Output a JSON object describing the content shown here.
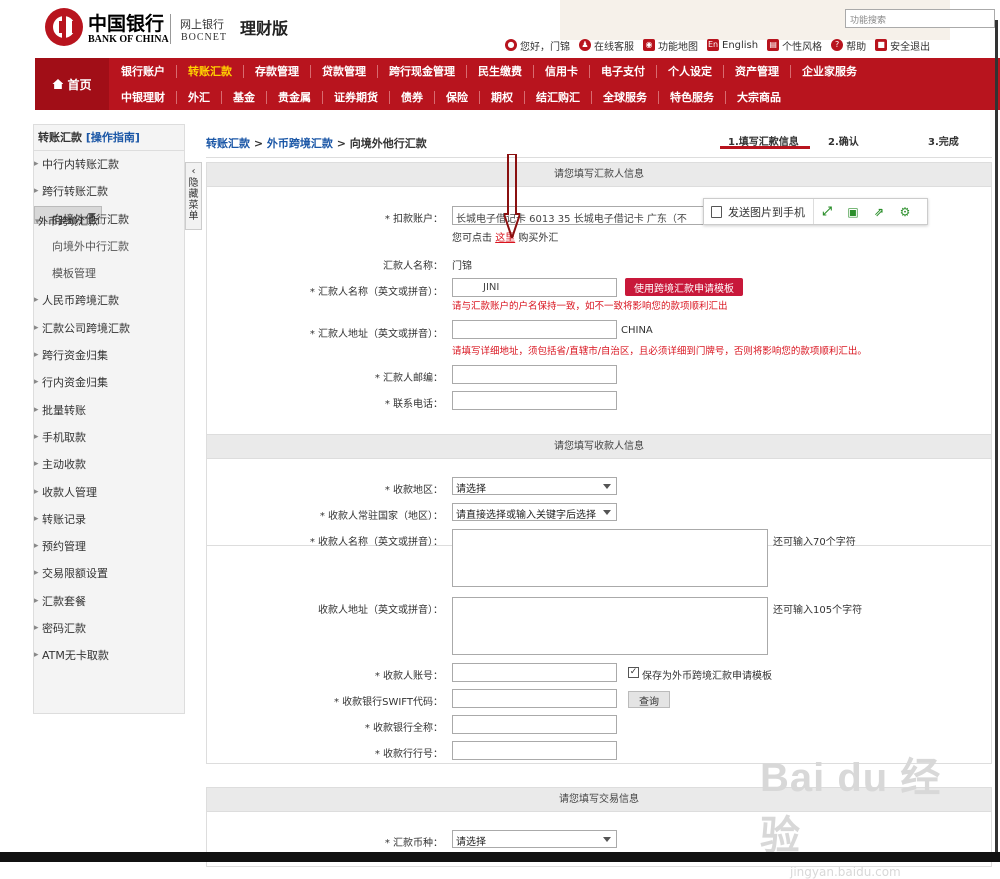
{
  "header": {
    "bank_cn": "中国银行",
    "bank_en": "BANK OF CHINA",
    "netbank_cn": "网上银行",
    "netbank_en": "BOCNET",
    "edition": "理财版",
    "search_placeholder": "功能搜索",
    "links": [
      {
        "icon": "user-icon",
        "label": "您好，门锦"
      },
      {
        "icon": "service-icon",
        "label": "在线客服"
      },
      {
        "icon": "map-icon",
        "label": "功能地图"
      },
      {
        "icon": "english-icon",
        "label": "English"
      },
      {
        "icon": "style-icon",
        "label": "个性风格"
      },
      {
        "icon": "help-icon",
        "label": "帮助"
      },
      {
        "icon": "lock-icon",
        "label": "安全退出"
      }
    ]
  },
  "nav": {
    "home": "首页",
    "row1": [
      "银行账户",
      "转账汇款",
      "存款管理",
      "贷款管理",
      "跨行现金管理",
      "民生缴费",
      "信用卡",
      "电子支付",
      "个人设定",
      "资产管理",
      "企业家服务"
    ],
    "row2": [
      "中银理财",
      "外汇",
      "基金",
      "贵金属",
      "证券期货",
      "债券",
      "保险",
      "期权",
      "结汇购汇",
      "全球服务",
      "特色服务",
      "大宗商品"
    ],
    "active": "转账汇款"
  },
  "sidebar": {
    "title": "转账汇款",
    "guide": "[操作指南]",
    "hide_label": "隐藏菜单",
    "items": [
      {
        "label": "中行内转账汇款",
        "type": "item"
      },
      {
        "label": "跨行转账汇款",
        "type": "item"
      },
      {
        "label": "外币跨境汇款",
        "type": "expanded"
      },
      {
        "label": "向境外他行汇款",
        "type": "sub-active"
      },
      {
        "label": "向境外中行汇款",
        "type": "sub"
      },
      {
        "label": "模板管理",
        "type": "sub"
      },
      {
        "label": "人民币跨境汇款",
        "type": "item"
      },
      {
        "label": "汇款公司跨境汇款",
        "type": "item"
      },
      {
        "label": "跨行资金归集",
        "type": "item"
      },
      {
        "label": "行内资金归集",
        "type": "item"
      },
      {
        "label": "批量转账",
        "type": "item"
      },
      {
        "label": "手机取款",
        "type": "item"
      },
      {
        "label": "主动收款",
        "type": "item"
      },
      {
        "label": "收款人管理",
        "type": "item"
      },
      {
        "label": "转账记录",
        "type": "item"
      },
      {
        "label": "预约管理",
        "type": "item"
      },
      {
        "label": "交易限额设置",
        "type": "item"
      },
      {
        "label": "汇款套餐",
        "type": "item"
      },
      {
        "label": "密码汇款",
        "type": "item"
      },
      {
        "label": "ATM无卡取款",
        "type": "item"
      }
    ]
  },
  "breadcrumb": {
    "c1": "转账汇款",
    "c2": "外币跨境汇款",
    "c3": "向境外他行汇款"
  },
  "steps": [
    "1.填写汇款信息",
    "2.确认",
    "3.完成"
  ],
  "remitter": {
    "title": "请您填写汇款人信息",
    "account_label": "扣款账户：",
    "account_value": "长城电子借记卡 6013          35 长城电子借记卡 广东（不",
    "buy_prefix": "您可点击",
    "buy_link": "这里",
    "buy_suffix": "购买外汇",
    "name_label": "汇款人名称：",
    "name_value": "门锦",
    "en_name_label": "汇款人名称（英文或拼音）：",
    "en_name_value": "JINI",
    "template_btn": "使用跨境汇款申请模板",
    "en_name_warn": "请与汇款账户的户名保持一致，如不一致将影响您的款项顺利汇出",
    "addr_label": "汇款人地址（英文或拼音）：",
    "addr_suffix": "CHINA",
    "addr_warn": "请填写详细地址，须包括省/直辖市/自治区，且必须详细到门牌号，否则将影响您的款项顺利汇出。",
    "zip_label": "汇款人邮编：",
    "phone_label": "联系电话："
  },
  "payee": {
    "title": "请您填写收款人信息",
    "region_label": "收款地区：",
    "region_value": "请选择",
    "country_label": "收款人常驻国家（地区）：",
    "country_value": "请直接选择或输入关键字后选择",
    "name_label": "收款人名称（英文或拼音）：",
    "name_hint": "还可输入70个字符",
    "addr_label": "收款人地址（英文或拼音）：",
    "addr_hint": "还可输入105个字符",
    "acct_label": "收款人账号：",
    "save_label": "保存为外币跨境汇款申请模板",
    "swift_label": "收款银行SWIFT代码：",
    "query_btn": "查询",
    "bank_name_label": "收款银行全称：",
    "bank_no_label": "收款行行号："
  },
  "trade": {
    "title": "请您填写交易信息",
    "currency_label": "汇款币种：",
    "currency_value": "请选择"
  },
  "phone_toolbar": {
    "send": "发送图片到手机"
  },
  "watermark": {
    "brand": "Bai du 经验",
    "url": "jingyan.baidu.com"
  }
}
